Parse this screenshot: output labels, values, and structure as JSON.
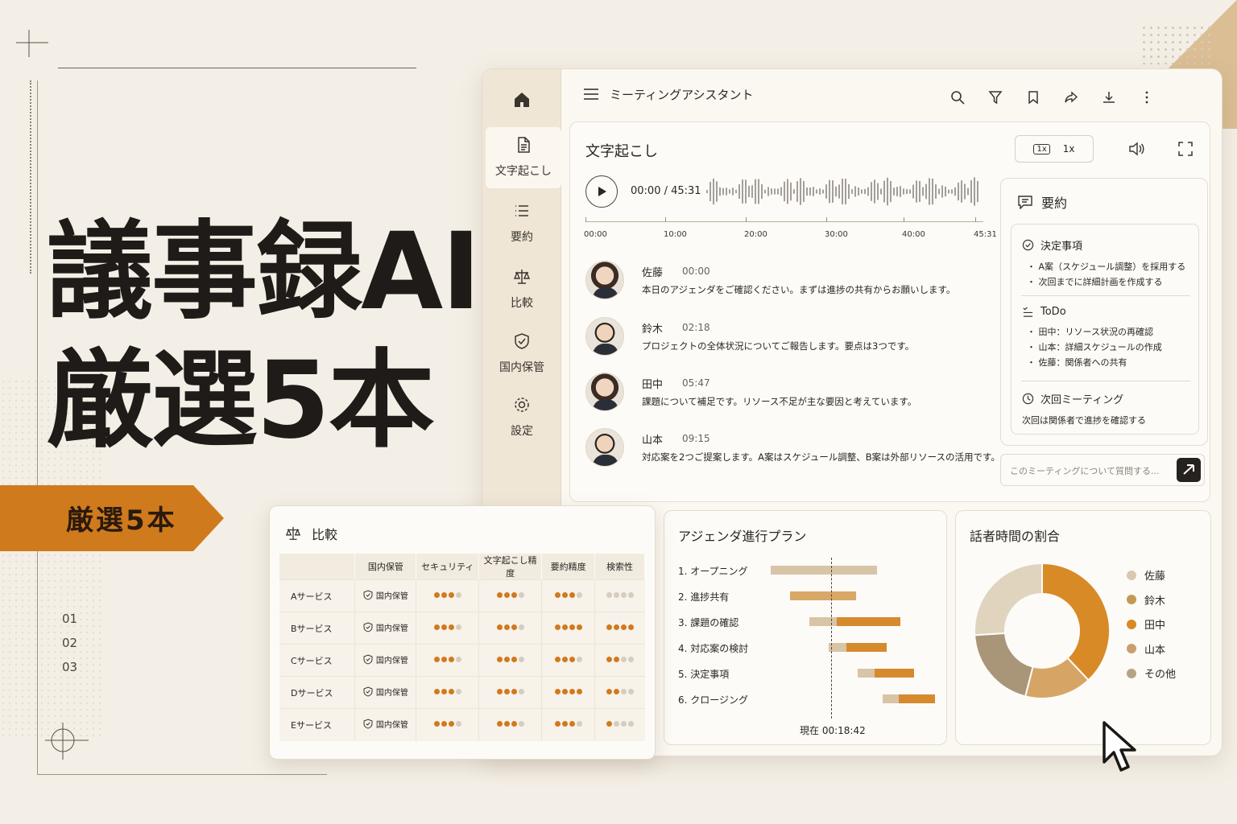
{
  "hero": {
    "line1": "議事録AI",
    "line2": "厳選5本",
    "ribbon": "厳選5本",
    "numbers": [
      "01",
      "02",
      "03"
    ]
  },
  "app": {
    "title": "ミーティングアシスタント",
    "sidebar": [
      {
        "label": "",
        "icon": "home-icon"
      },
      {
        "label": "文字起こし",
        "icon": "document-icon"
      },
      {
        "label": "要約",
        "icon": "list-icon"
      },
      {
        "label": "比較",
        "icon": "scale-icon"
      },
      {
        "label": "国内保管",
        "icon": "shield-icon"
      },
      {
        "label": "設定",
        "icon": "gear-icon"
      }
    ],
    "topbar_icons": [
      "search-icon",
      "filter-icon",
      "bookmark-icon",
      "share-icon",
      "download-icon",
      "more-icon"
    ]
  },
  "transcript": {
    "title": "文字起こし",
    "speed_badge": "1x",
    "speed_label": "1x",
    "time": "00:00 / 45:31",
    "timeline_labels": [
      "00:00",
      "10:00",
      "20:00",
      "30:00",
      "40:00",
      "45:31"
    ],
    "entries": [
      {
        "name": "佐藤",
        "time": "00:00",
        "text": "本日のアジェンダをご確認ください。まずは進捗の共有からお願いします。",
        "gender": "f"
      },
      {
        "name": "鈴木",
        "time": "02:18",
        "text": "プロジェクトの全体状況についてご報告します。要点は3つです。",
        "gender": "m"
      },
      {
        "name": "田中",
        "time": "05:47",
        "text": "課題について補足です。リソース不足が主な要因と考えています。",
        "gender": "f"
      },
      {
        "name": "山本",
        "time": "09:15",
        "text": "対応案を2つご提案します。A案はスケジュール調整、B案は外部リソースの活用です。",
        "gender": "m"
      }
    ]
  },
  "summary": {
    "title": "要約",
    "decisions": {
      "heading": "決定事項",
      "items": [
        "・ A案（スケジュール調整）を採用する",
        "・ 次回までに詳細計画を作成する"
      ]
    },
    "todo": {
      "heading": "ToDo",
      "items": [
        "・ 田中：リソース状況の再確認",
        "・ 山本：詳細スケジュールの作成",
        "・ 佐藤：関係者への共有"
      ]
    },
    "next": {
      "heading": "次回ミーティング",
      "text": "次回は関係者で進捗を確認する"
    },
    "ask_placeholder": "このミーティングについて質問する..."
  },
  "agenda": {
    "title": "アジェンダ進行プラン",
    "now_label": "現在  00:18:42",
    "items": [
      {
        "label": "1.  オープニング",
        "start": 0.0,
        "end": 0.55,
        "done": 0.55
      },
      {
        "label": "2.  進捗共有",
        "start": 0.1,
        "end": 0.44,
        "done": 0.0
      },
      {
        "label": "3.  課題の確認",
        "start": 0.2,
        "end": 0.67,
        "done": 0.15
      },
      {
        "label": "4.  対応案の検討",
        "start": 0.3,
        "end": 0.6,
        "done": 0.15
      },
      {
        "label": "5.  決定事項",
        "start": 0.45,
        "end": 0.74,
        "done": 0.13
      },
      {
        "label": "6.  クロージング",
        "start": 0.58,
        "end": 0.85,
        "done": 0.27
      }
    ]
  },
  "speaker_share": {
    "title": "話者時間の割合",
    "legend": [
      {
        "name": "佐藤",
        "color": "#d9c9b0"
      },
      {
        "name": "鈴木",
        "color": "#c49a52"
      },
      {
        "name": "田中",
        "color": "#d88a26"
      },
      {
        "name": "山本",
        "color": "#c8a070"
      },
      {
        "name": "その他",
        "color": "#b6a386"
      }
    ]
  },
  "chart_data": {
    "type": "pie",
    "title": "話者時間の割合",
    "categories": [
      "田中",
      "鈴木",
      "その他",
      "佐藤"
    ],
    "values": [
      38,
      16,
      20,
      26
    ],
    "colors": [
      "#d88a26",
      "#d6a566",
      "#a99578",
      "#e0d4bf"
    ]
  },
  "compare": {
    "title": "比較",
    "columns": [
      "",
      "国内保管",
      "セキュリティ",
      "文字起こし精度",
      "要約精度",
      "検索性"
    ],
    "storage_label": "国内保管",
    "rows": [
      {
        "name": "Aサービス",
        "ratings": [
          3,
          3,
          3,
          0
        ]
      },
      {
        "name": "Bサービス",
        "ratings": [
          3,
          3,
          4,
          4
        ]
      },
      {
        "name": "Cサービス",
        "ratings": [
          3,
          3,
          3,
          2
        ]
      },
      {
        "name": "Dサービス",
        "ratings": [
          3,
          3,
          4,
          2
        ]
      },
      {
        "name": "Eサービス",
        "ratings": [
          3,
          3,
          3,
          1
        ]
      }
    ]
  },
  "colors": {
    "accent": "#d07a1e",
    "dot_on": "#d07a1e",
    "dot_off": "#d6cdbf"
  }
}
